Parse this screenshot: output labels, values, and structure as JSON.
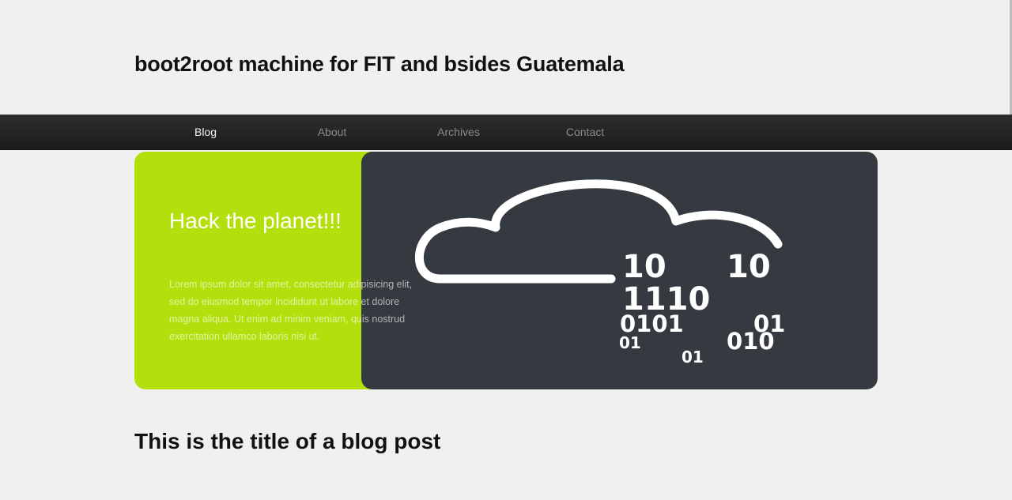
{
  "site": {
    "title": "boot2root machine for FIT and bsides Guatemala"
  },
  "nav": {
    "items": [
      {
        "label": "Blog",
        "active": true
      },
      {
        "label": "About",
        "active": false
      },
      {
        "label": "Archives",
        "active": false
      },
      {
        "label": "Contact",
        "active": false
      }
    ]
  },
  "hero": {
    "title": "Hack the planet!!!",
    "text": "Lorem ipsum dolor sit amet, consectetur adipisicing elit, sed do eiusmod tempor incididunt ut labore et dolore magna aliqua. Ut enim ad minim veniam, quis nostrud exercitation ullamco laboris nisi ut.",
    "image": {
      "icon": "cloud-binary-icon",
      "binary_digits": [
        "10",
        "10",
        "1110",
        "0101",
        "01",
        "01",
        "010",
        "01"
      ]
    },
    "colors": {
      "accent": "#b3df0c",
      "panel": "#343a40"
    }
  },
  "post": {
    "title": "This is the title of a blog post"
  }
}
